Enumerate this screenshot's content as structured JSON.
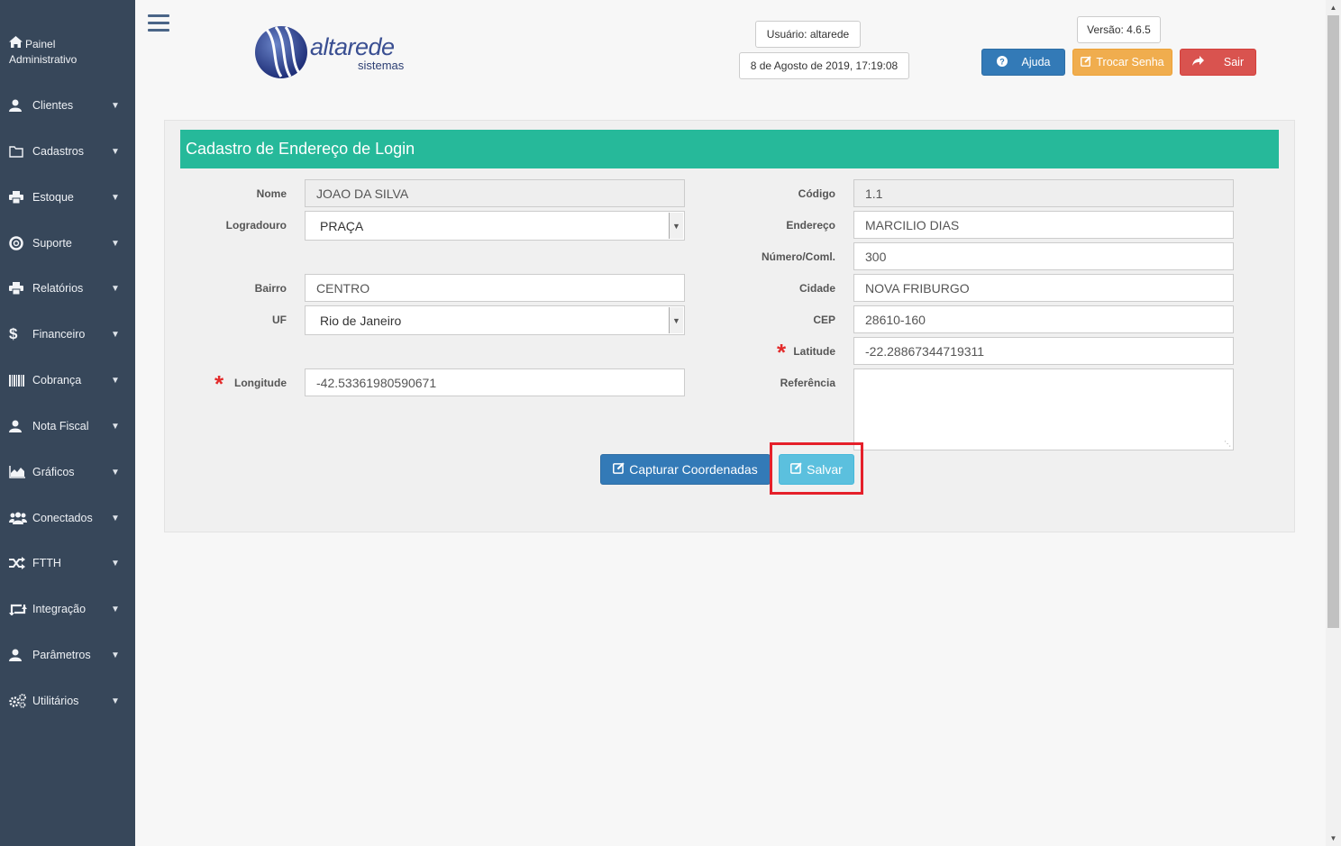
{
  "sidebar": {
    "brand": {
      "line1": "Painel",
      "line2": "Administrativo"
    },
    "items": [
      {
        "label": "Clientes",
        "icon": "user-icon"
      },
      {
        "label": "Cadastros",
        "icon": "folder-icon"
      },
      {
        "label": "Estoque",
        "icon": "printer-icon"
      },
      {
        "label": "Suporte",
        "icon": "lifebuoy-icon"
      },
      {
        "label": "Relatórios",
        "icon": "printer-icon"
      },
      {
        "label": "Financeiro",
        "icon": "dollar-icon"
      },
      {
        "label": "Cobrança",
        "icon": "barcode-icon"
      },
      {
        "label": "Nota Fiscal",
        "icon": "user-icon"
      },
      {
        "label": "Gráficos",
        "icon": "area-chart-icon"
      },
      {
        "label": "Conectados",
        "icon": "users-icon"
      },
      {
        "label": "FTTH",
        "icon": "random-icon"
      },
      {
        "label": "Integração",
        "icon": "retweet-icon"
      },
      {
        "label": "Parâmetros",
        "icon": "user-icon"
      },
      {
        "label": "Utilitários",
        "icon": "cogs-icon"
      }
    ]
  },
  "header": {
    "logo_text": "altarede",
    "logo_sub": "sistemas",
    "user": "Usuário: altarede",
    "datetime": "8 de Agosto de 2019, 17:19:08",
    "version": "Versão: 4.6.5",
    "help_label": "Ajuda",
    "change_password_label": "Trocar Senha",
    "logout_label": "Sair"
  },
  "form": {
    "title": "Cadastro de Endereço de Login",
    "nome": {
      "label": "Nome",
      "value": "JOAO DA SILVA"
    },
    "logradouro": {
      "label": "Logradouro",
      "value": "PRAÇA"
    },
    "bairro": {
      "label": "Bairro",
      "value": "CENTRO"
    },
    "uf": {
      "label": "UF",
      "value": "Rio de Janeiro"
    },
    "longitude": {
      "label": "Longitude",
      "value": "-42.53361980590671"
    },
    "codigo": {
      "label": "Código",
      "value": "1.1"
    },
    "endereco": {
      "label": "Endereço",
      "value": "MARCILIO DIAS"
    },
    "numero": {
      "label": "Número/Coml.",
      "value": "300"
    },
    "cidade": {
      "label": "Cidade",
      "value": "NOVA FRIBURGO"
    },
    "cep": {
      "label": "CEP",
      "value": "28610-160"
    },
    "latitude": {
      "label": "Latitude",
      "value": "-22.28867344719311"
    },
    "referencia": {
      "label": "Referência",
      "value": ""
    },
    "required_mark": "*",
    "capture_label": "Capturar Coordenadas",
    "save_label": "Salvar"
  },
  "colors": {
    "sidebar_bg": "#37475a",
    "header_green": "#26b99a",
    "primary": "#337ab7",
    "warning": "#f0ad4e",
    "danger": "#d9534f",
    "info": "#5bc0de",
    "highlight": "#e5202a"
  }
}
